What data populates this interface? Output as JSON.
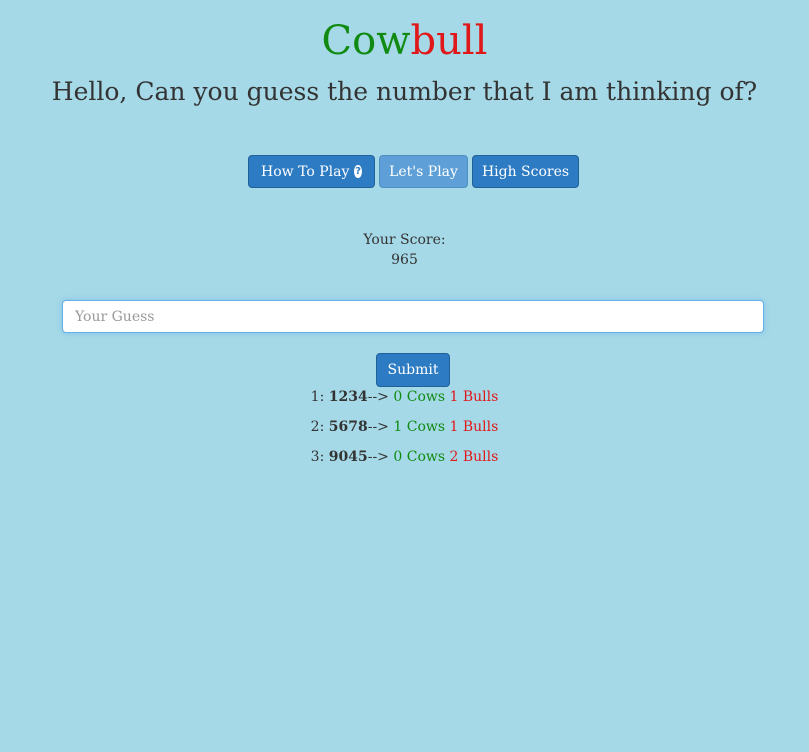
{
  "header": {
    "title_part1": "Cow",
    "title_part2": "bull",
    "subtitle": "Hello, Can you guess the number that I am thinking of?"
  },
  "nav": {
    "how_to_play": "How To Play",
    "lets_play": "Let's Play",
    "high_scores": "High Scores",
    "help_icon": "question-circle-icon"
  },
  "score": {
    "label": "Your Score:",
    "value": "965"
  },
  "guess": {
    "placeholder": "Your Guess",
    "value": ""
  },
  "submit_label": "Submit",
  "history": [
    {
      "index": "1:",
      "guess": "1234",
      "arrow": "-->",
      "cows": "0 Cows",
      "bulls": "1 Bulls"
    },
    {
      "index": "2:",
      "guess": "5678",
      "arrow": "-->",
      "cows": "1 Cows",
      "bulls": "1 Bulls"
    },
    {
      "index": "3:",
      "guess": "9045",
      "arrow": "-->",
      "cows": "0 Cows",
      "bulls": "2 Bulls"
    }
  ],
  "colors": {
    "background": "#a5d9e7",
    "cow": "#118a11",
    "bull": "#e0181a",
    "button": "#2d7bc3",
    "button_active": "#5d9fd6"
  }
}
